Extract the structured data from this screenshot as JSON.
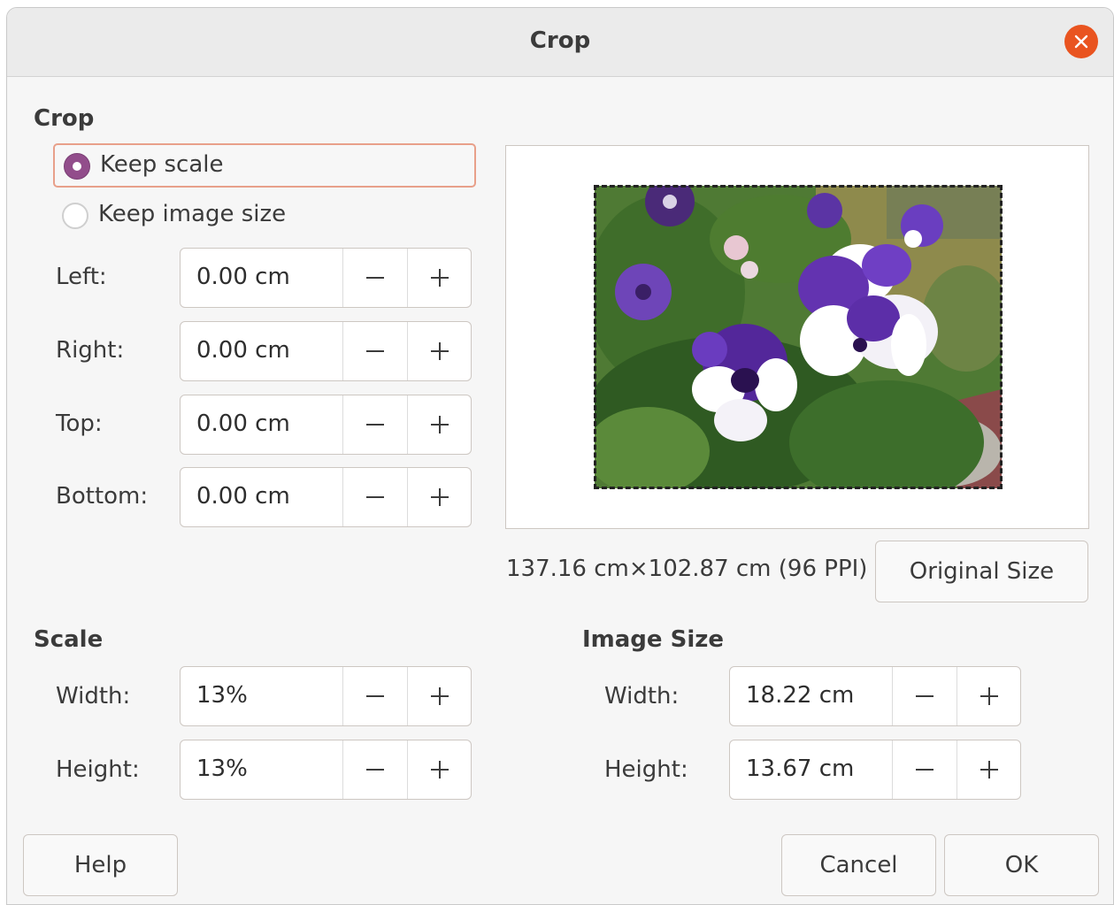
{
  "dialog": {
    "title": "Crop"
  },
  "crop": {
    "section_title": "Crop",
    "keep_scale_label": "Keep scale",
    "keep_image_size_label": "Keep image size",
    "left_label": "Left:",
    "left_value": "0.00 cm",
    "right_label": "Right:",
    "right_value": "0.00 cm",
    "top_label": "Top:",
    "top_value": "0.00 cm",
    "bottom_label": "Bottom:",
    "bottom_value": "0.00 cm",
    "selected_option": "Keep scale"
  },
  "preview": {
    "original_info": "137.16 cm×102.87 cm (96 PPI)",
    "original_size_button": "Original Size"
  },
  "scale": {
    "section_title": "Scale",
    "width_label": "Width:",
    "width_value": "13%",
    "height_label": "Height:",
    "height_value": "13%"
  },
  "image_size": {
    "section_title": "Image Size",
    "width_label": "Width:",
    "width_value": "18.22 cm",
    "height_label": "Height:",
    "height_value": "13.67 cm"
  },
  "buttons": {
    "help": "Help",
    "cancel": "Cancel",
    "ok": "OK"
  },
  "icons": {
    "close": "close-icon",
    "minus": "minus-icon",
    "plus": "plus-icon"
  },
  "colors": {
    "accent": "#e95420",
    "radio_checked": "#924d8b",
    "focus_border": "#e8a08a"
  }
}
